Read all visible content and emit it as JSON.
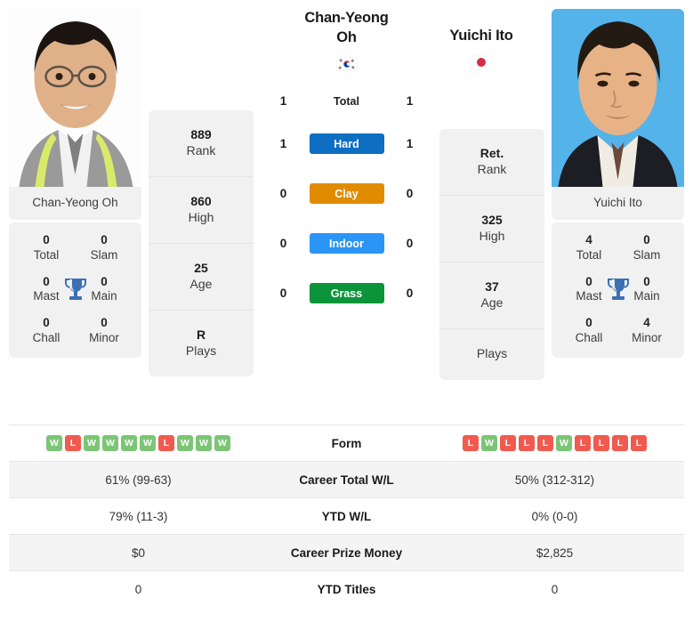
{
  "colors": {
    "hard": "#0d6ec2",
    "clay": "#e18c00",
    "indoor": "#2b95f5",
    "grass": "#0b9439",
    "win": "#7cc576",
    "loss": "#f05a4f",
    "card_bg": "#f1f1f1",
    "row_alt": "#f4f4f4"
  },
  "player_left": {
    "name_line1": "Chan-Yeong",
    "name_line2": "Oh",
    "full_name": "Chan-Yeong Oh",
    "flag": "south-korea-flag",
    "country": "South Korea",
    "stats": [
      {
        "value": "889",
        "label": "Rank"
      },
      {
        "value": "860",
        "label": "High"
      },
      {
        "value": "25",
        "label": "Age"
      },
      {
        "value": "R",
        "label": "Plays"
      }
    ],
    "titles": [
      {
        "value": "0",
        "label": "Total"
      },
      {
        "value": "0",
        "label": "Slam"
      },
      {
        "value": "0",
        "label": "Mast"
      },
      {
        "value": "0",
        "label": "Main"
      },
      {
        "value": "0",
        "label": "Chall"
      },
      {
        "value": "0",
        "label": "Minor"
      }
    ],
    "form": [
      "W",
      "L",
      "W",
      "W",
      "W",
      "W",
      "L",
      "W",
      "W",
      "W"
    ]
  },
  "player_right": {
    "name_line1": "Yuichi Ito",
    "name_line2": "",
    "full_name": "Yuichi Ito",
    "flag": "japan-flag",
    "country": "Japan",
    "stats": [
      {
        "value": "Ret.",
        "label": "Rank"
      },
      {
        "value": "325",
        "label": "High"
      },
      {
        "value": "37",
        "label": "Age"
      },
      {
        "value": "",
        "label": "Plays"
      }
    ],
    "titles": [
      {
        "value": "4",
        "label": "Total"
      },
      {
        "value": "0",
        "label": "Slam"
      },
      {
        "value": "0",
        "label": "Mast"
      },
      {
        "value": "0",
        "label": "Main"
      },
      {
        "value": "0",
        "label": "Chall"
      },
      {
        "value": "4",
        "label": "Minor"
      }
    ],
    "form": [
      "L",
      "W",
      "L",
      "L",
      "L",
      "W",
      "L",
      "L",
      "L",
      "L"
    ]
  },
  "h2h": {
    "total": {
      "label": "Total",
      "left": "1",
      "right": "1"
    },
    "surfaces": [
      {
        "label": "Hard",
        "left": "1",
        "right": "1",
        "color": "#0d6ec2"
      },
      {
        "label": "Clay",
        "left": "0",
        "right": "0",
        "color": "#e18c00"
      },
      {
        "label": "Indoor",
        "left": "0",
        "right": "0",
        "color": "#2b95f5"
      },
      {
        "label": "Grass",
        "left": "0",
        "right": "0",
        "color": "#0b9439"
      }
    ]
  },
  "comparison_rows": [
    {
      "label": "Form",
      "left": "",
      "right": "",
      "type": "form"
    },
    {
      "label": "Career Total W/L",
      "left": "61% (99-63)",
      "right": "50% (312-312)",
      "type": "text"
    },
    {
      "label": "YTD W/L",
      "left": "79% (11-3)",
      "right": "0% (0-0)",
      "type": "text"
    },
    {
      "label": "Career Prize Money",
      "left": "$0",
      "right": "$2,825",
      "type": "text"
    },
    {
      "label": "YTD Titles",
      "left": "0",
      "right": "0",
      "type": "text"
    }
  ]
}
